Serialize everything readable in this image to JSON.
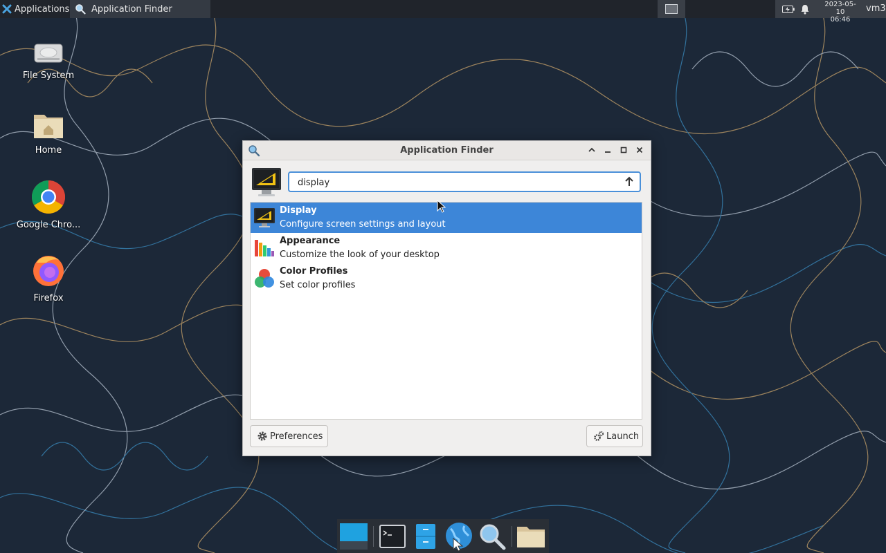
{
  "panel": {
    "apps_menu_label": "Applications",
    "task_label": "Application Finder",
    "clock_date": "2023-05-10",
    "clock_time": "06:46",
    "user": "vm3"
  },
  "desktop_icons": [
    {
      "label": "File System",
      "icon": "drive-icon"
    },
    {
      "label": "Home",
      "icon": "home-folder-icon"
    },
    {
      "label": "Google Chro...",
      "icon": "chrome-icon"
    },
    {
      "label": "Firefox",
      "icon": "firefox-icon"
    }
  ],
  "window": {
    "title": "Application Finder",
    "search": {
      "value": "display",
      "placeholder": ""
    },
    "results": [
      {
        "name": "Display",
        "description": "Configure screen settings and layout",
        "icon": "display-icon",
        "selected": true
      },
      {
        "name": "Appearance",
        "description": "Customize the look of your desktop",
        "icon": "appearance-icon",
        "selected": false
      },
      {
        "name": "Color Profiles",
        "description": "Set color profiles",
        "icon": "color-profiles-icon",
        "selected": false
      }
    ],
    "preferences_label": "Preferences",
    "launch_label": "Launch"
  },
  "dock": {
    "items": [
      "show-desktop-icon",
      "terminal-icon",
      "file-cabinet-icon",
      "web-browser-icon",
      "app-finder-icon",
      "folder-icon"
    ]
  },
  "colors": {
    "selection": "#3d86d8",
    "wallpaper": "#1c2838",
    "panel": "#20242b"
  }
}
